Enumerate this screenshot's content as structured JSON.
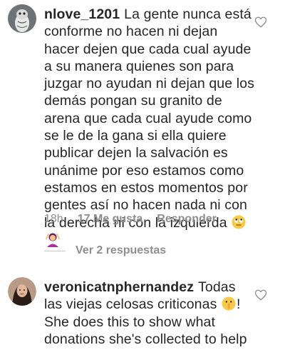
{
  "comments": [
    {
      "username": "nlove_1201",
      "text": "La gente nunca está conforme no hacen ni dejan hacer dejen que cada cual ayude a su manera quienes son para juzgar no ayudan ni dejan que los demás pongan su granito de arena que cada cual ayude como se le de la gana si ella quiere publicar dejen la salvación es unánime por eso estamos como estamos en estos momentos por gentes así no hacen nada ni con la derecha ni con la izquierda",
      "emojis": [
        "face-with-rolling-eyes-emoji",
        "person-raising-hand-emoji"
      ],
      "time": "18h",
      "likes": "17 Me gusta",
      "reply_label": "Responder",
      "view_replies": "Ver 2 respuestas"
    },
    {
      "username": "veronicatnphernandez",
      "text_before_emoji": "Todas las viejas celosas criticonas",
      "emoji": "shushing-face-emoji",
      "text_after_emoji": "! She does this to show what donations she's collected to help others in need! Aver o"
    }
  ],
  "icons": {
    "like": "heart-outline-icon"
  },
  "colors": {
    "text": "#262626",
    "secondary": "#8e8e8e",
    "background": "#ffffff"
  }
}
